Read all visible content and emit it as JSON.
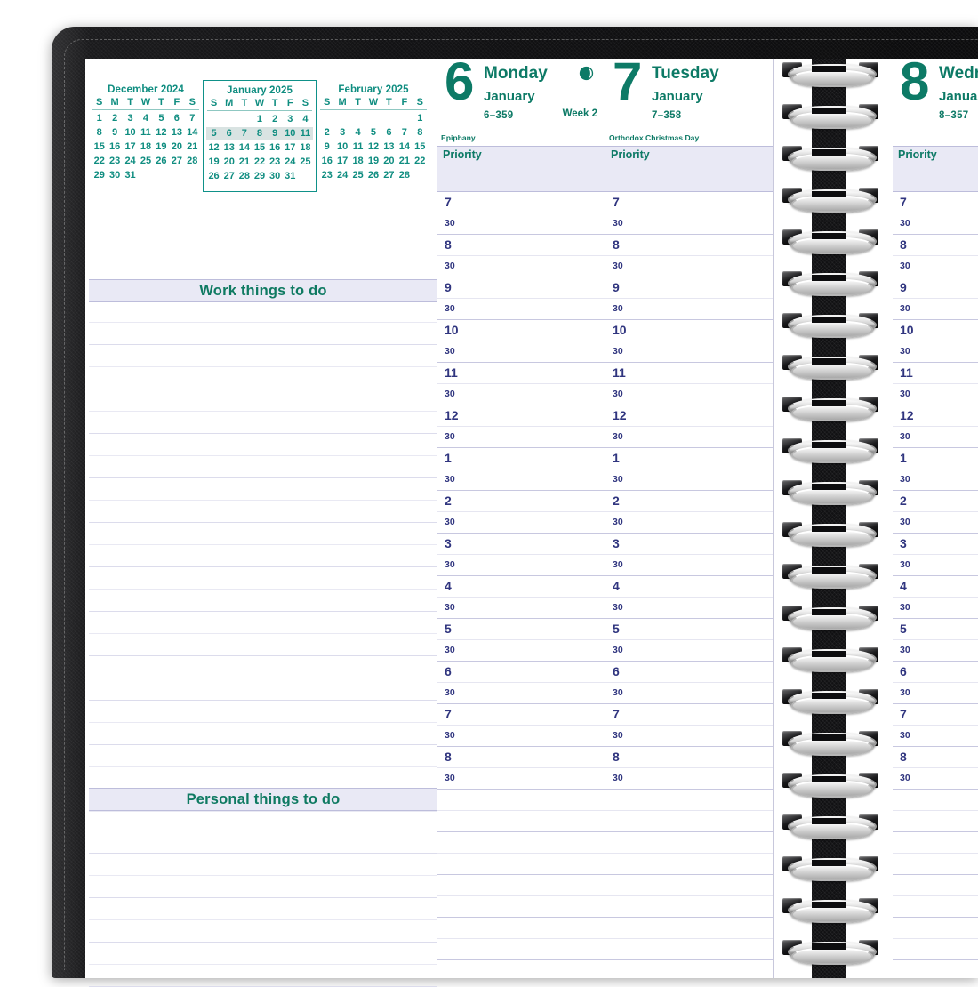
{
  "product": {
    "type": "weekly-planner",
    "cover_color": "#111113",
    "accent_green": "#0d7a66",
    "accent_teal": "#0f8d80",
    "time_color": "#30357f",
    "band_color": "#e9e9f5"
  },
  "mini_calendars": [
    {
      "title": "December 2024",
      "highlighted": false,
      "dow": [
        "S",
        "M",
        "T",
        "W",
        "T",
        "F",
        "S"
      ],
      "lead_blanks": 0,
      "days": [
        1,
        2,
        3,
        4,
        5,
        6,
        7,
        8,
        9,
        10,
        11,
        12,
        13,
        14,
        15,
        16,
        17,
        18,
        19,
        20,
        21,
        22,
        23,
        24,
        25,
        26,
        27,
        28,
        29,
        30,
        31
      ],
      "highlight_days": []
    },
    {
      "title": "January 2025",
      "highlighted": true,
      "dow": [
        "S",
        "M",
        "T",
        "W",
        "T",
        "F",
        "S"
      ],
      "lead_blanks": 3,
      "days": [
        1,
        2,
        3,
        4,
        5,
        6,
        7,
        8,
        9,
        10,
        11,
        12,
        13,
        14,
        15,
        16,
        17,
        18,
        19,
        20,
        21,
        22,
        23,
        24,
        25,
        26,
        27,
        28,
        29,
        30,
        31
      ],
      "highlight_days": [
        5,
        6,
        7,
        8,
        9,
        10,
        11
      ]
    },
    {
      "title": "February 2025",
      "highlighted": false,
      "dow": [
        "S",
        "M",
        "T",
        "W",
        "T",
        "F",
        "S"
      ],
      "lead_blanks": 6,
      "days": [
        1,
        2,
        3,
        4,
        5,
        6,
        7,
        8,
        9,
        10,
        11,
        12,
        13,
        14,
        15,
        16,
        17,
        18,
        19,
        20,
        21,
        22,
        23,
        24,
        25,
        26,
        27,
        28
      ],
      "highlight_days": []
    }
  ],
  "left_page": {
    "work_section_title": "Work things to do",
    "personal_section_title": "Personal things to do",
    "work_rule_count": 23,
    "personal_rule_count": 8
  },
  "days": [
    {
      "number": "6",
      "weekday": "Monday",
      "month": "January",
      "julian": "6–359",
      "holiday": "Epiphany",
      "priority_label": "Priority",
      "week_label": "Week 2",
      "moon_phase": "first-quarter",
      "has_moon": true
    },
    {
      "number": "7",
      "weekday": "Tuesday",
      "month": "January",
      "julian": "7–358",
      "holiday": "Orthodox Christmas Day",
      "priority_label": "Priority",
      "week_label": "",
      "moon_phase": "",
      "has_moon": false
    },
    {
      "number": "8",
      "weekday": "Wednesday",
      "month": "January",
      "julian": "8–357",
      "holiday": "",
      "priority_label": "Priority",
      "week_label": "",
      "moon_phase": "",
      "has_moon": false
    }
  ],
  "time_slots": [
    {
      "hour": "7",
      "half": "30"
    },
    {
      "hour": "8",
      "half": "30"
    },
    {
      "hour": "9",
      "half": "30"
    },
    {
      "hour": "10",
      "half": "30"
    },
    {
      "hour": "11",
      "half": "30"
    },
    {
      "hour": "12",
      "half": "30"
    },
    {
      "hour": "1",
      "half": "30"
    },
    {
      "hour": "2",
      "half": "30"
    },
    {
      "hour": "3",
      "half": "30"
    },
    {
      "hour": "4",
      "half": "30"
    },
    {
      "hour": "5",
      "half": "30"
    },
    {
      "hour": "6",
      "half": "30"
    },
    {
      "hour": "7",
      "half": "30"
    },
    {
      "hour": "8",
      "half": "30"
    }
  ],
  "binding": {
    "type": "twin-wire-spiral",
    "loop_count": 22
  }
}
